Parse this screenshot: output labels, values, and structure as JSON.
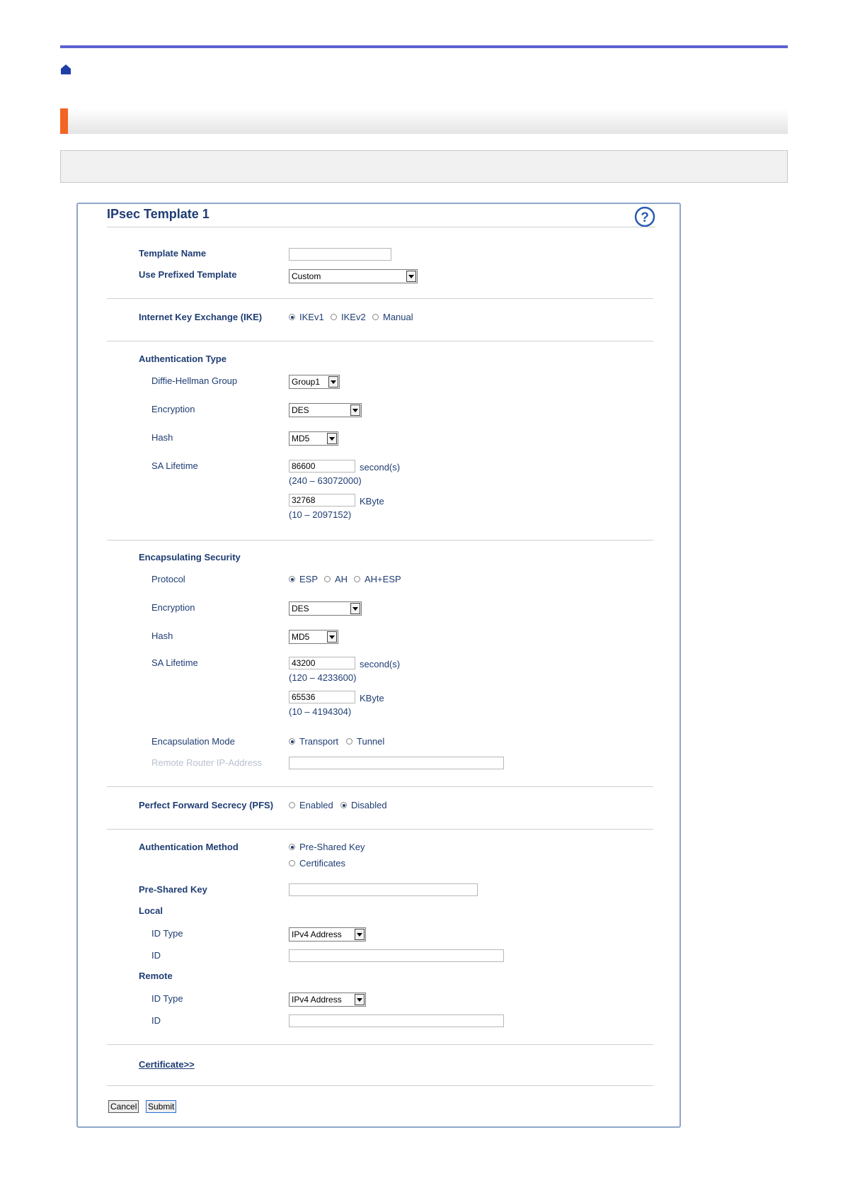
{
  "panel": {
    "title": "IPsec Template 1"
  },
  "template": {
    "name_label": "Template Name",
    "name_value": "",
    "prefixed_label": "Use Prefixed Template",
    "prefixed_value": "Custom"
  },
  "ike": {
    "label": "Internet Key Exchange (IKE)",
    "options": [
      "IKEv1",
      "IKEv2",
      "Manual"
    ],
    "selected": "IKEv1"
  },
  "auth_type": {
    "heading": "Authentication Type",
    "dh_label": "Diffie-Hellman Group",
    "dh_value": "Group1",
    "enc_label": "Encryption",
    "enc_value": "DES",
    "hash_label": "Hash",
    "hash_value": "MD5",
    "sa_label": "SA Lifetime",
    "sa_seconds": "86600",
    "sa_seconds_unit": "second(s)",
    "sa_seconds_range": "(240 – 63072000)",
    "sa_kbyte": "32768",
    "sa_kbyte_unit": "KByte",
    "sa_kbyte_range": "(10 – 2097152)"
  },
  "encap": {
    "heading": "Encapsulating Security",
    "protocol_label": "Protocol",
    "protocol_options": [
      "ESP",
      "AH",
      "AH+ESP"
    ],
    "protocol_selected": "ESP",
    "enc_label": "Encryption",
    "enc_value": "DES",
    "hash_label": "Hash",
    "hash_value": "MD5",
    "sa_label": "SA Lifetime",
    "sa_seconds": "43200",
    "sa_seconds_unit": "second(s)",
    "sa_seconds_range": "(120 – 4233600)",
    "sa_kbyte": "65536",
    "sa_kbyte_unit": "KByte",
    "sa_kbyte_range": "(10 – 4194304)",
    "mode_label": "Encapsulation Mode",
    "mode_options": [
      "Transport",
      "Tunnel"
    ],
    "mode_selected": "Transport",
    "remote_label": "Remote Router IP-Address",
    "remote_value": ""
  },
  "pfs": {
    "label": "Perfect Forward Secrecy (PFS)",
    "options": [
      "Enabled",
      "Disabled"
    ],
    "selected": "Disabled"
  },
  "auth_method": {
    "label": "Authentication Method",
    "options": [
      "Pre-Shared Key",
      "Certificates"
    ],
    "selected": "Pre-Shared Key",
    "psk_label": "Pre-Shared Key",
    "psk_value": "",
    "local_heading": "Local",
    "local_idtype_label": "ID Type",
    "local_idtype_value": "IPv4 Address",
    "local_id_label": "ID",
    "local_id_value": "",
    "remote_heading": "Remote",
    "remote_idtype_label": "ID Type",
    "remote_idtype_value": "IPv4 Address",
    "remote_id_label": "ID",
    "remote_id_value": ""
  },
  "certificate_link": "Certificate>>",
  "buttons": {
    "cancel": "Cancel",
    "submit": "Submit"
  },
  "colors": {
    "rule": "#5b62d1",
    "accent": "#f26522",
    "text": "#1f3d73"
  },
  "icons": [
    "home-icon",
    "help-icon"
  ]
}
